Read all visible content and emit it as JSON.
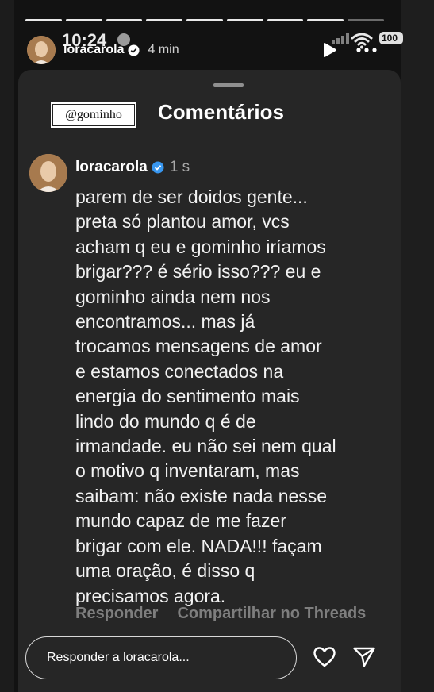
{
  "status_bar": {
    "time": "10:24",
    "battery": "100"
  },
  "story": {
    "username": "loracarola",
    "posted_ago": "4 min",
    "progress_segments": 9,
    "progress_viewed": 8
  },
  "sheet": {
    "title": "Comentários",
    "mention_sticker": "@gominho"
  },
  "comment": {
    "username": "loracarola",
    "time_ago": "1 s",
    "text": "parem de ser doidos gente...\npreta só plantou amor, vcs\nacham q eu e gominho iríamos\nbrigar??? é sério isso??? eu e\ngominho ainda nem nos\nencontramos... mas já\ntrocamos mensagens de amor\ne estamos conectados na\nenergia do sentimento mais\nlindo do mundo q é de\nirmandade. eu não sei nem qual\no motivo q inventaram, mas\nsaibam: não existe nada nesse\nmundo capaz de me fazer\nbrigar com ele. NADA!!! façam\numa oração, é disso q\nprecisamos agora.",
    "actions": {
      "reply": "Responder",
      "share": "Compartilhar no Threads"
    }
  },
  "reply_bar": {
    "placeholder": "Responder a loracarola..."
  },
  "icons": {
    "verified": "verified-badge-icon",
    "heart": "heart-icon",
    "send": "send-icon",
    "play": "play-icon",
    "more": "more-icon"
  },
  "colors": {
    "sheet_bg": "#262626",
    "verified_blue": "#3897f0",
    "muted": "#7e7e7e"
  }
}
